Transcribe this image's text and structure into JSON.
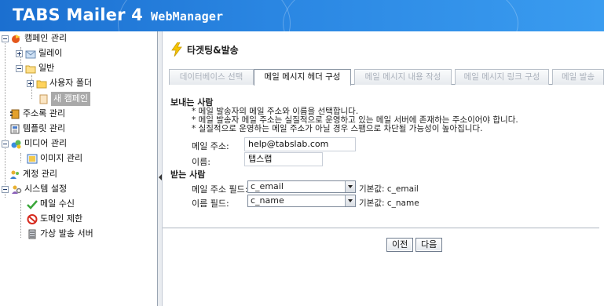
{
  "app": {
    "title": "TABS Mailer 4",
    "subtitle": "WebManager"
  },
  "sidebar": {
    "items": [
      {
        "label": "캠페인 관리",
        "icon": "campaign-icon"
      },
      {
        "label": "릴레이",
        "icon": "mail-folder-icon"
      },
      {
        "label": "일반",
        "icon": "open-folder-icon"
      },
      {
        "label": "사용자 폴더",
        "icon": "folder-icon"
      },
      {
        "label": "새 캠페인",
        "icon": "page-icon",
        "selected": true
      },
      {
        "label": "주소록 관리",
        "icon": "addressbook-icon"
      },
      {
        "label": "템플릿 관리",
        "icon": "template-icon"
      },
      {
        "label": "미디어 관리",
        "icon": "media-icon"
      },
      {
        "label": "이미지 관리",
        "icon": "image-icon"
      },
      {
        "label": "계정 관리",
        "icon": "account-icon"
      },
      {
        "label": "시스템 설정",
        "icon": "settings-icon"
      },
      {
        "label": "메일 수신",
        "icon": "checkmark-icon"
      },
      {
        "label": "도메인 제한",
        "icon": "block-icon"
      },
      {
        "label": "가상 발송 서버",
        "icon": "server-icon"
      }
    ]
  },
  "main": {
    "page_title": "타겟팅&발송",
    "tabs": [
      {
        "label": "데이터베이스 선택"
      },
      {
        "label": "메일 메시지 헤더 구성",
        "active": true
      },
      {
        "label": "메일 메시지 내용 작성"
      },
      {
        "label": "메일 메시지 링크 구성"
      },
      {
        "label": "메일 발송"
      }
    ],
    "sender": {
      "title": "보내는 사람",
      "notes": [
        "* 메일 발송자의 메일 주소와 이름을 선택합니다.",
        "* 메일 발송자 메일 주소는 실질적으로 운영하고 있는 메일 서버에 존재하는 주소이어야 합니다.",
        "* 실질적으로 운영하는 메일 주소가 아닐 경우 스팸으로 차단될 가능성이 높아집니다."
      ],
      "email_label": "메일 주소:",
      "email_value": "help@tabslab.com",
      "name_label": "이름:",
      "name_value": "탭스랩"
    },
    "receiver": {
      "title": "받는 사람",
      "email_field_label": "메일 주소 필드:",
      "email_field_value": "c_email",
      "email_default": "기본값: c_email",
      "name_field_label": "이름 필드:",
      "name_field_value": "c_name",
      "name_default": "기본값: c_name"
    },
    "buttons": {
      "prev": "이전",
      "next": "다음"
    }
  },
  "colors": {
    "header_blue": "#2a86e2",
    "accent_yellow": "#f5c400"
  }
}
